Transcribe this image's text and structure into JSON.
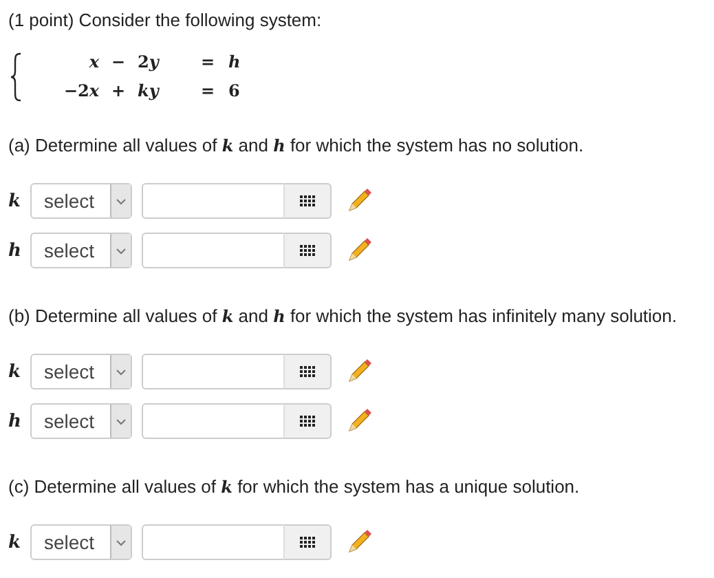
{
  "intro": "(1 point) Consider the following system:",
  "system": [
    [
      [
        {
          "kind": "var",
          "text": "x"
        }
      ],
      [
        {
          "kind": "num",
          "text": "−"
        }
      ],
      [
        {
          "kind": "num",
          "text": "2"
        },
        {
          "kind": "var",
          "text": "y"
        }
      ],
      [
        {
          "kind": "num",
          "text": "="
        }
      ],
      [
        {
          "kind": "var",
          "text": "h"
        }
      ]
    ],
    [
      [
        {
          "kind": "num",
          "text": "−2"
        },
        {
          "kind": "var",
          "text": "x"
        }
      ],
      [
        {
          "kind": "num",
          "text": "+"
        }
      ],
      [
        {
          "kind": "var",
          "text": "k"
        },
        {
          "kind": "var",
          "text": "y"
        }
      ],
      [
        {
          "kind": "num",
          "text": "="
        }
      ],
      [
        {
          "kind": "num",
          "text": "6"
        }
      ]
    ]
  ],
  "parts": [
    {
      "question": "(a) Determine all values of *k* and *h* for which the system has no solution.",
      "answers": [
        {
          "variable": "k",
          "select": "select"
        },
        {
          "variable": "h",
          "select": "select"
        }
      ]
    },
    {
      "question": "(b) Determine all values of *k* and *h* for which the system has infinitely many solution.",
      "answers": [
        {
          "variable": "k",
          "select": "select"
        },
        {
          "variable": "h",
          "select": "select"
        }
      ]
    },
    {
      "question": "(c) Determine all values of *k* for which the system has a unique solution.",
      "answers": [
        {
          "variable": "k",
          "select": "select"
        }
      ]
    }
  ]
}
